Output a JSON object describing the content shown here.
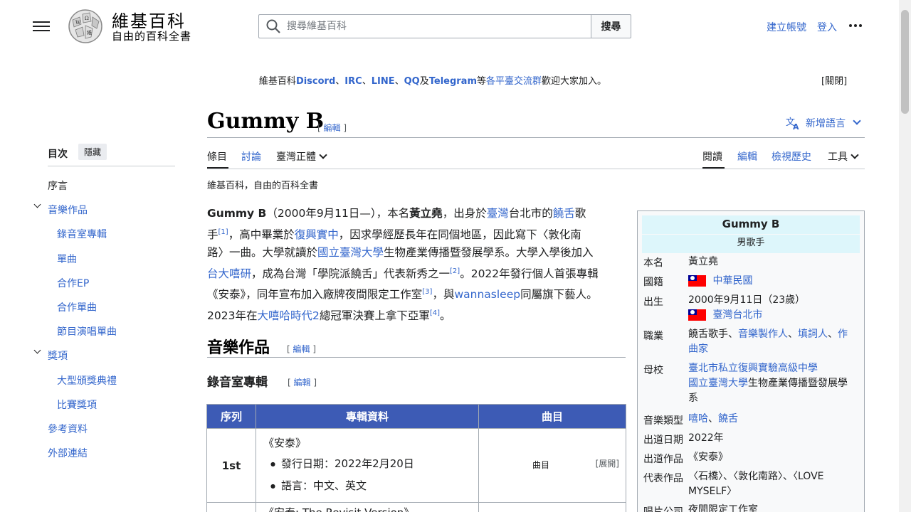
{
  "header": {
    "site_title": "維基百科",
    "tagline": "自由的百科全書",
    "search_placeholder": "搜尋維基百科",
    "search_button": "搜尋",
    "create_account": "建立帳號",
    "login": "登入"
  },
  "notice": {
    "prefix": "維基百科",
    "discord": "Discord",
    "sep1": "、",
    "irc": "IRC",
    "sep2": "、",
    "line": "LINE",
    "sep3": "、",
    "qq": "QQ",
    "and": "及",
    "telegram": "Telegram",
    "mid": "等",
    "groups": "各平臺交流群",
    "suffix": "歡迎大家加入。",
    "close": "[關閉]"
  },
  "article": {
    "title": "Gummy B",
    "edit": "編輯",
    "add_languages": "新增語言",
    "tabs": {
      "article": "條目",
      "talk": "討論",
      "variant": "臺灣正體",
      "read": "閱讀",
      "edit": "編輯",
      "history": "檢視歷史",
      "tools": "工具"
    },
    "subtitle": "維基百科，自由的百科全書",
    "section_music": "音樂作品",
    "section_studio": "錄音室專輯"
  },
  "lead": {
    "l1a": "Gummy B",
    "l1b": "（2000年9月11日—），本名",
    "l1c": "黃立堯",
    "l1d": "，出身於",
    "l1e": "臺灣",
    "l1f": "台北市的",
    "l1g": "饒舌",
    "l1h": "歌",
    "l2a": "手",
    "ref1": "[1]",
    "l2b": "，高中畢業於",
    "l2c": "復興實中",
    "l2d": "，因求學經歷長年在同個地區，因此寫下〈敦化南",
    "l3a": "路〉一曲。大學就讀於",
    "l3b": "國立臺灣大學",
    "l3c": "生物產業傳播暨發展學系。大學入學後加入",
    "l4a": "台大嘻研",
    "l4b": "，成為台灣「學院派饒舌」代表新秀之一",
    "ref2": "[2]",
    "l4c": "。2022年發行個人首張專輯",
    "l5a": "《安泰》，同年宣布加入廠牌夜間限定工作室",
    "ref3": "[3]",
    "l5b": "，與",
    "l5c": "wannasleep",
    "l5d": "同屬旗下藝人。",
    "l6a": "2023年在",
    "l6b": "大嘻哈時代2",
    "l6c": "總冠軍決賽上拿下亞軍",
    "ref4": "[4]",
    "l6d": "。"
  },
  "toc": {
    "heading": "目次",
    "hide": "隱藏",
    "items": [
      "序言",
      "音樂作品",
      "錄音室專輯",
      "單曲",
      "合作EP",
      "合作單曲",
      "節目演唱單曲",
      "獎項",
      "大型頒獎典禮",
      "比賽獎項",
      "參考資料",
      "外部連結"
    ]
  },
  "album_table": {
    "headers": [
      "序列",
      "專輯資料",
      "曲目"
    ],
    "rows": [
      {
        "rank": "1st",
        "title": "《安泰》",
        "release": "發行日期：2022年2月20日",
        "language": "語言：中文、英文",
        "tracks": "曲目",
        "expand": "[展開]"
      },
      {
        "title": "《安泰: The Revisit Version》"
      }
    ]
  },
  "infobox": {
    "name": "Gummy B",
    "occupation_title": "男歌手",
    "rows": {
      "real_name_label": "本名",
      "real_name": "黃立堯",
      "nationality_label": "國籍",
      "nationality": "中華民國",
      "born_label": "出生",
      "born_date": "2000年9月11日（23歲）",
      "born_place": "臺灣台北市",
      "job_label": "職業",
      "job_a": "饒舌歌手、",
      "job_b": "音樂製作人",
      "job_c": "、",
      "job_d": "填詞人",
      "job_e": "、",
      "job_f": "作曲家",
      "school_label": "母校",
      "school_1": "臺北市私立復興實驗高級中學",
      "school_2a": "國立臺灣大學",
      "school_2b": "生物產業傳播暨發展學系",
      "genre_label": "音樂類型",
      "genre_a": "嘻哈",
      "genre_sep": "、",
      "genre_b": "饒舌",
      "debut_date_label": "出道日期",
      "debut_date": "2022年",
      "debut_work_label": "出道作品",
      "debut_work": "《安泰》",
      "works_label": "代表作品",
      "works": "〈石橋〉、〈敦化南路〉、〈LOVE MYSELF〉",
      "label_label": "唱片公司",
      "label": "夜間限定工作室"
    }
  }
}
